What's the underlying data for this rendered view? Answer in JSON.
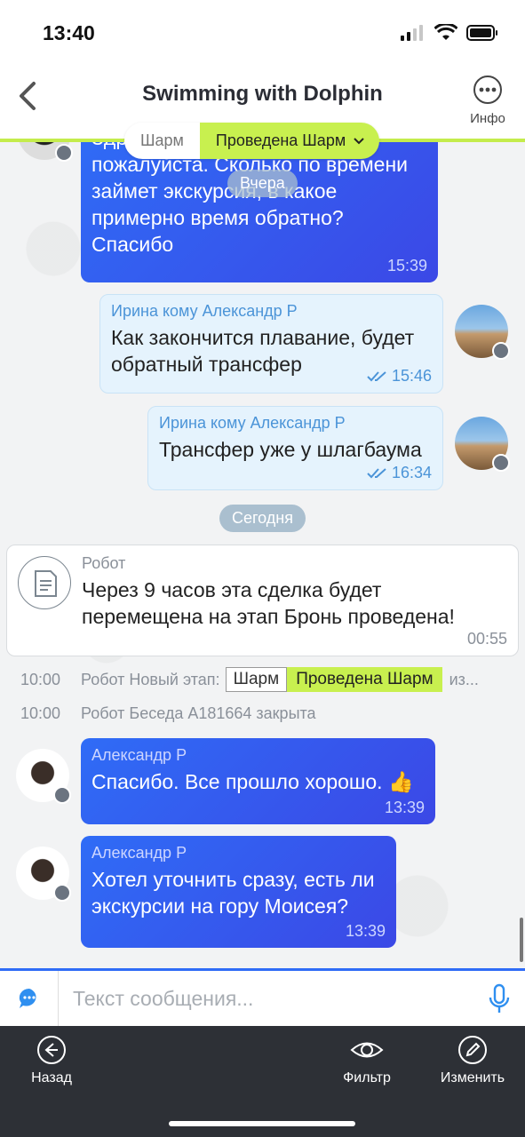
{
  "status_bar": {
    "time": "13:40"
  },
  "header": {
    "title": "Swimming with Dolphin",
    "info_label": "Инфо"
  },
  "stage": {
    "first": "Шарм",
    "second": "Проведена Шарм"
  },
  "messages": [
    {
      "text": "Здравствуйте, пожалуйста. Сколько по времени займет экскурсия, в какое примерно время обратно? Спасибо",
      "line1": "Здр",
      "line2": "пожалуйста. Сколько по времени",
      "line3": "займет экскурсия, в какое",
      "line4": "примерно время обратно?",
      "line5": "Спасибо",
      "time": "15:39"
    },
    {
      "author": "Ирина кому Александр Р",
      "line1": "Как закончится плавание, будет",
      "line2": "обратный трансфер",
      "time": "15:46"
    },
    {
      "author": "Ирина кому Александр Р",
      "line1": "Трансфер уже у шлагбаума",
      "time": "16:34"
    },
    {
      "author": "Александр Р",
      "line1": "Спасибо. Все прошло хорошо. 👍",
      "time": "13:39"
    },
    {
      "author": "Александр Р",
      "line1": "Хотел уточнить сразу, есть ли",
      "line2": "экскурсии на гору Моисея?",
      "time": "13:39"
    }
  ],
  "dates": {
    "yesterday": "Вчера",
    "today": "Сегодня"
  },
  "robot": {
    "author": "Робот",
    "line1": "Через 9 часов эта сделка будет",
    "line2": "перемещена на этап Бронь проведена!",
    "time": "00:55"
  },
  "system": [
    {
      "time": "10:00",
      "text": "Робот Новый этап:",
      "stage_first": "Шарм",
      "stage_second": "Проведена Шарм",
      "suffix": "из..."
    },
    {
      "time": "10:00",
      "text": "Робот Беседа A181664 закрыта"
    }
  ],
  "input": {
    "placeholder": "Текст сообщения..."
  },
  "toolbar": {
    "back": "Назад",
    "filter": "Фильтр",
    "edit": "Изменить"
  },
  "colors": {
    "accent": "#2f6cf6",
    "stage_green": "#c8f04f",
    "toolbar_bg": "#2d3036"
  }
}
